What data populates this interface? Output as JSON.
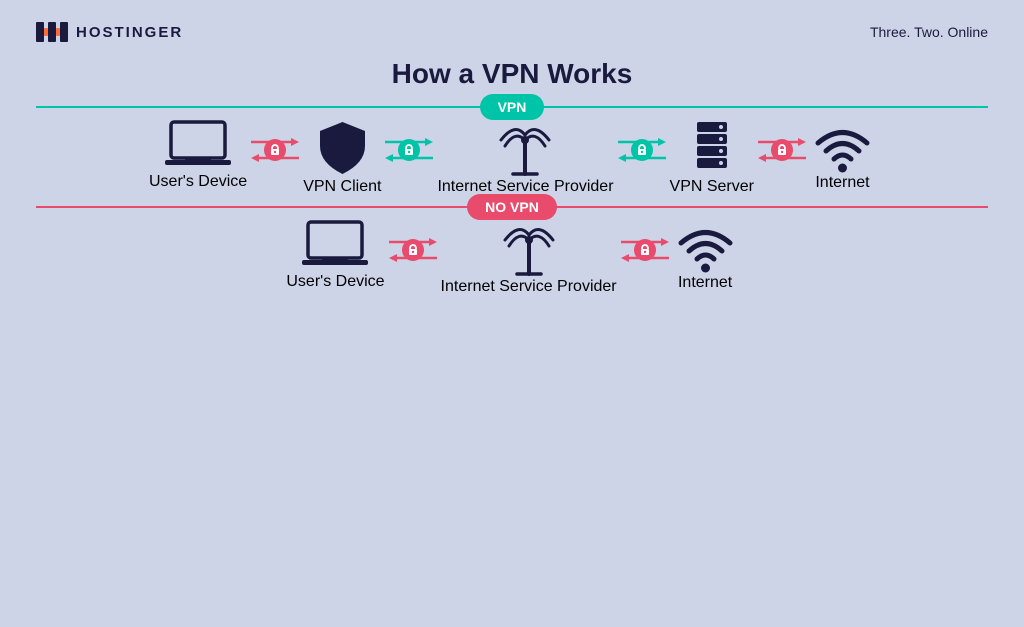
{
  "header": {
    "logo_text": "HOSTINGER",
    "tagline": "Three. Two. Online"
  },
  "main_title": "How a VPN Works",
  "vpn_section": {
    "badge": "VPN",
    "items": [
      {
        "label": "User's Device",
        "icon": "laptop"
      },
      {
        "label": "VPN Client",
        "icon": "shield"
      },
      {
        "label": "Internet Service Provider",
        "icon": "antenna"
      },
      {
        "label": "VPN Server",
        "icon": "server"
      },
      {
        "label": "Internet",
        "icon": "wifi"
      }
    ],
    "connectors": [
      {
        "color": "red",
        "type": "bidirectional"
      },
      {
        "color": "green",
        "type": "bidirectional"
      },
      {
        "color": "green",
        "type": "bidirectional"
      },
      {
        "color": "red",
        "type": "bidirectional"
      }
    ]
  },
  "novpn_section": {
    "badge": "NO VPN",
    "items": [
      {
        "label": "User's Device",
        "icon": "laptop"
      },
      {
        "label": "Internet Service Provider",
        "icon": "antenna"
      },
      {
        "label": "Internet",
        "icon": "wifi"
      }
    ],
    "connectors": [
      {
        "color": "red",
        "type": "bidirectional"
      },
      {
        "color": "red",
        "type": "bidirectional"
      }
    ]
  },
  "colors": {
    "bg": "#cdd4e8",
    "navy": "#1a1a3e",
    "teal": "#00c4a7",
    "red": "#e84b6b",
    "white": "#ffffff"
  }
}
